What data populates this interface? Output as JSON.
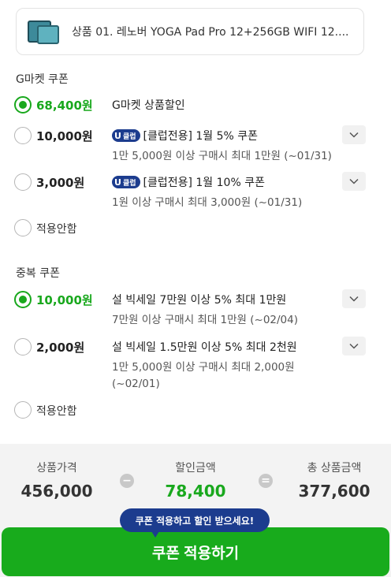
{
  "product": {
    "name": "상품 01. 레노버 YOGA Pad Pro 12+256GB WIFI 12...."
  },
  "gmarket_coupon": {
    "title": "G마켓 쿠폰",
    "options": [
      {
        "amount": "68,400원",
        "badge": "",
        "line1": "G마켓 상품할인",
        "line2": "",
        "selected": true
      },
      {
        "amount": "10,000원",
        "badge": "클럽",
        "line1": "[클럽전용] 1월 5% 쿠폰",
        "line2": "1만 5,000원 이상 구매시 최대 1만원 (~01/31)",
        "selected": false
      },
      {
        "amount": "3,000원",
        "badge": "클럽",
        "line1": "[클럽전용] 1월 10% 쿠폰",
        "line2": "1원 이상 구매시 최대 3,000원 (~01/31)",
        "selected": false
      }
    ],
    "none_label": "적용안함"
  },
  "duplicate_coupon": {
    "title": "중복 쿠폰",
    "options": [
      {
        "amount": "10,000원",
        "line1": "설 빅세일 7만원 이상 5% 최대 1만원",
        "line2": "7만원 이상 구매시 최대 1만원 (~02/04)",
        "selected": true
      },
      {
        "amount": "2,000원",
        "line1": "설 빅세일 1.5만원 이상 5% 최대 2천원",
        "line2": "1만 5,000원 이상 구매시 최대 2,000원 (~02/01)",
        "selected": false
      }
    ],
    "none_label": "적용안함"
  },
  "summary": {
    "product_price_label": "상품가격",
    "product_price": "456,000",
    "minus": "−",
    "discount_label": "할인금액",
    "discount": "78,400",
    "equals": "=",
    "total_label": "총 상품금액",
    "total": "377,600"
  },
  "tooltip": "쿠폰 적용하고 할인 받으세요!",
  "apply_button": "쿠폰 적용하기",
  "colors": {
    "accent": "#19a81d",
    "club_badge": "#1c3c8e",
    "summary_bg": "#f3f3f3"
  },
  "badge_letter": "U"
}
